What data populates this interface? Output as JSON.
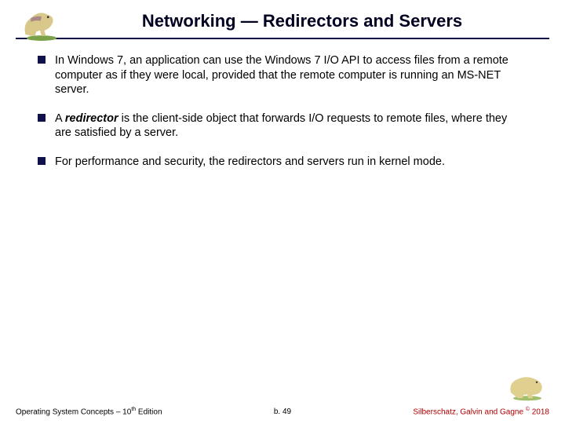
{
  "header": {
    "title": "Networking — Redirectors and Servers"
  },
  "bullets": [
    {
      "text_before": "In Windows 7, an application can use the Windows 7 I/O API to access files from a remote computer as if they were local, provided that the remote computer is running an MS-NET server.",
      "term": "",
      "text_after": ""
    },
    {
      "text_before": "A ",
      "term": "redirector",
      "text_after": " is the client-side object that forwards I/O requests to remote files, where they are satisfied by a server."
    },
    {
      "text_before": "For performance and security, the redirectors and servers run in kernel mode.",
      "term": "",
      "text_after": ""
    }
  ],
  "footer": {
    "left_before": "Operating System Concepts – 10",
    "left_sup": "th",
    "left_after": " Edition",
    "center": "b. 49",
    "right_before": "Silberschatz, Galvin and Gagne ",
    "right_cop": "©",
    "right_after": " 2018"
  }
}
